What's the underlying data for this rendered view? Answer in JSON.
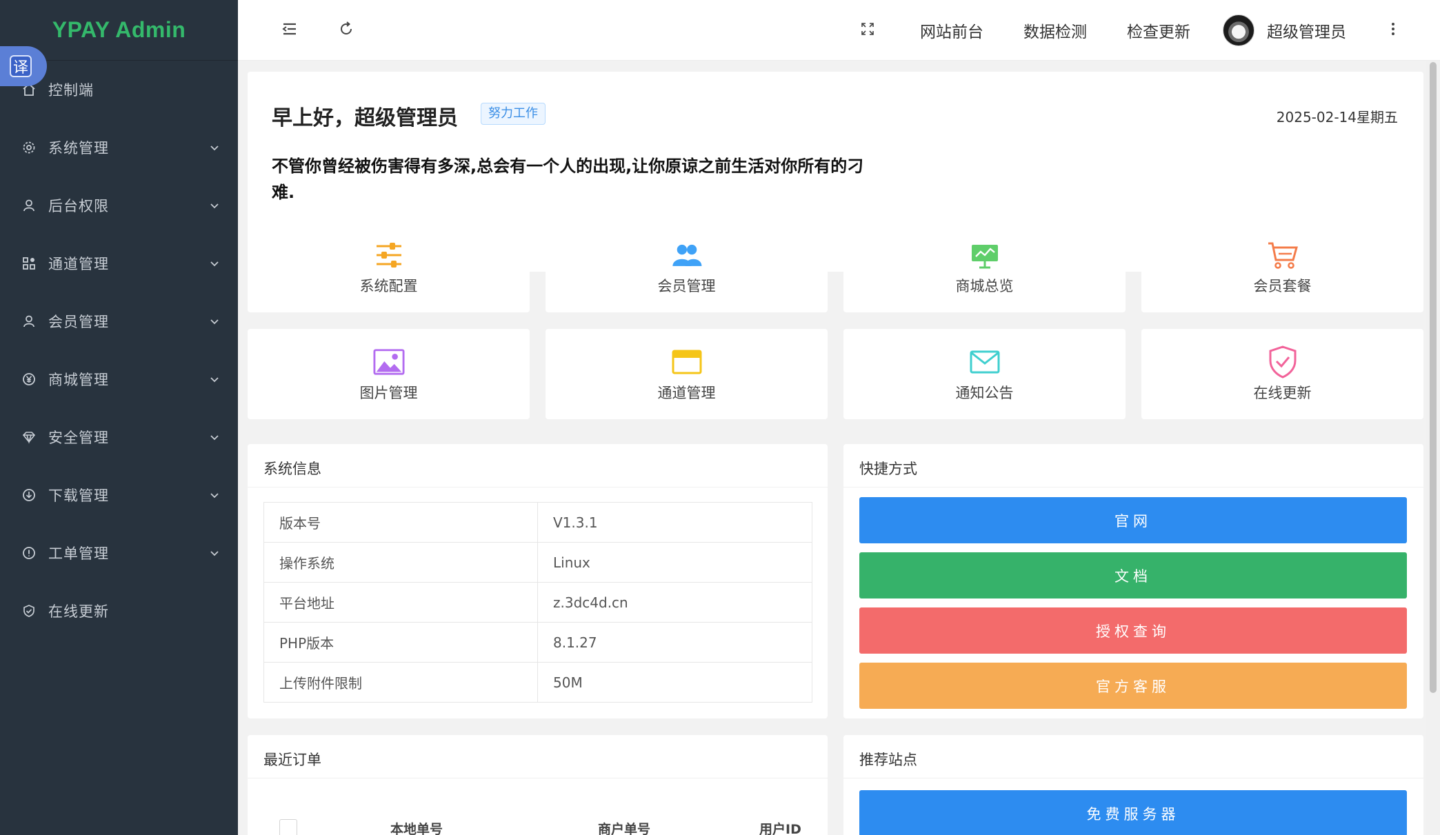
{
  "app": {
    "title": "YPAY Admin",
    "translate_badge": "译"
  },
  "sidebar": {
    "items": [
      {
        "label": "控制端",
        "icon": "home-icon",
        "has_children": false
      },
      {
        "label": "系统管理",
        "icon": "gear-icon",
        "has_children": true
      },
      {
        "label": "后台权限",
        "icon": "user-icon",
        "has_children": true
      },
      {
        "label": "通道管理",
        "icon": "apps-icon",
        "has_children": true
      },
      {
        "label": "会员管理",
        "icon": "user-icon",
        "has_children": true
      },
      {
        "label": "商城管理",
        "icon": "yen-icon",
        "has_children": true
      },
      {
        "label": "安全管理",
        "icon": "diamond-icon",
        "has_children": true
      },
      {
        "label": "下载管理",
        "icon": "download-icon",
        "has_children": true
      },
      {
        "label": "工单管理",
        "icon": "info-icon",
        "has_children": true
      },
      {
        "label": "在线更新",
        "icon": "shield-check-icon",
        "has_children": false
      }
    ]
  },
  "header": {
    "links": [
      "网站前台",
      "数据检测",
      "检查更新"
    ],
    "user_name": "超级管理员"
  },
  "welcome": {
    "greeting": "早上好，超级管理员",
    "tag": "努力工作",
    "date": "2025-02-14星期五",
    "quote": "不管你曾经被伤害得有多深,总会有一个人的出现,让你原谅之前生活对你所有的刁难."
  },
  "tiles": [
    {
      "label": "系统配置",
      "icon": "sliders-icon",
      "color": "#f5a623"
    },
    {
      "label": "会员管理",
      "icon": "users-icon",
      "color": "#3fa2f7"
    },
    {
      "label": "商城总览",
      "icon": "presentation-icon",
      "color": "#5fce6a"
    },
    {
      "label": "会员套餐",
      "icon": "cart-icon",
      "color": "#f47c4a"
    },
    {
      "label": "图片管理",
      "icon": "image-icon",
      "color": "#b36cf0"
    },
    {
      "label": "通道管理",
      "icon": "card-icon",
      "color": "#f5c518"
    },
    {
      "label": "通知公告",
      "icon": "mail-icon",
      "color": "#3fcfcf"
    },
    {
      "label": "在线更新",
      "icon": "shield-check-icon",
      "color": "#f2639a"
    }
  ],
  "system_info": {
    "title": "系统信息",
    "rows": [
      {
        "key": "版本号",
        "value": "V1.3.1"
      },
      {
        "key": "操作系统",
        "value": "Linux"
      },
      {
        "key": "平台地址",
        "value": "z.3dc4d.cn"
      },
      {
        "key": "PHP版本",
        "value": "8.1.27"
      },
      {
        "key": "上传附件限制",
        "value": "50M"
      }
    ]
  },
  "shortcuts": {
    "title": "快捷方式",
    "buttons": [
      {
        "label": "官网",
        "color": "#2d8cf0"
      },
      {
        "label": "文档",
        "color": "#36b26a"
      },
      {
        "label": "授权查询",
        "color": "#f36b6b"
      },
      {
        "label": "官方客服",
        "color": "#f6ab54"
      }
    ]
  },
  "recent_orders": {
    "title": "最近订单",
    "columns": [
      "本地单号",
      "商户单号",
      "用户ID"
    ]
  },
  "recommended": {
    "title": "推荐站点",
    "buttons": [
      {
        "label": "免费服务器",
        "color": "#2d8cf0"
      }
    ]
  }
}
